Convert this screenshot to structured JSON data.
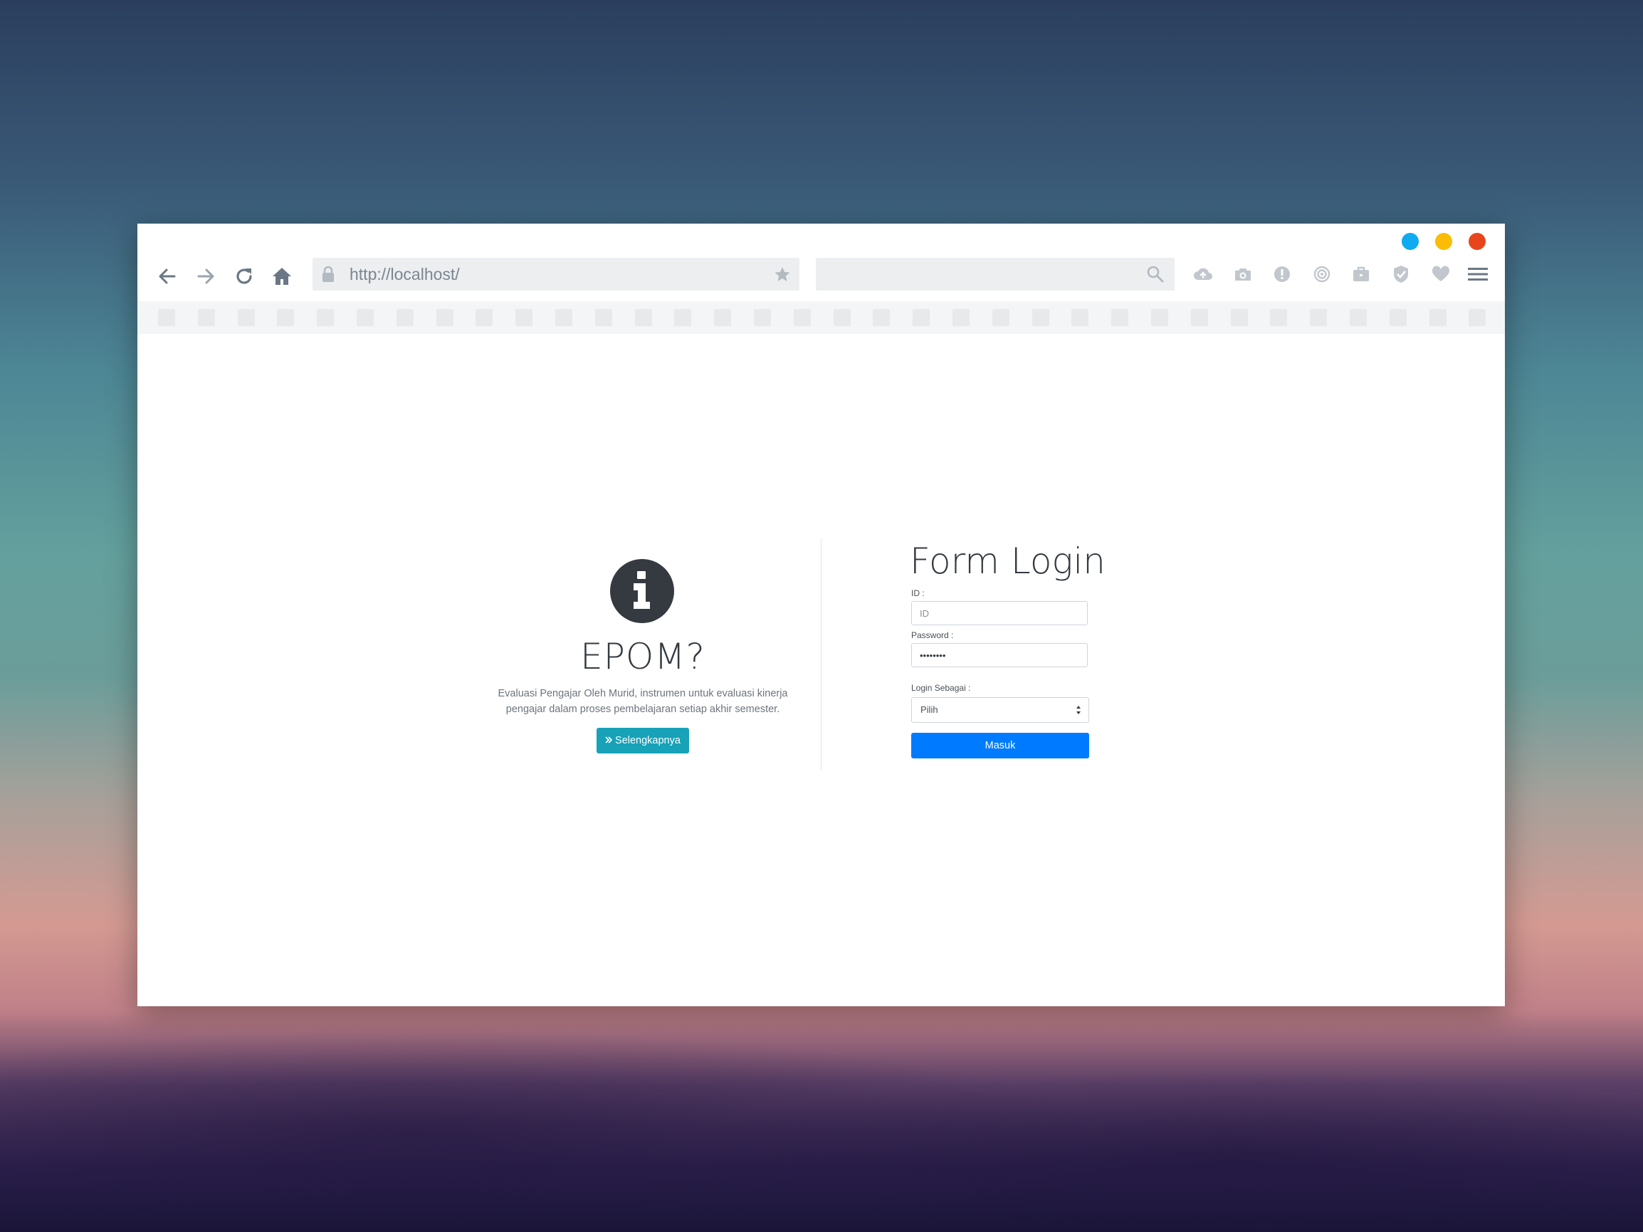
{
  "browser": {
    "url": "http://localhost/",
    "search_placeholder": "",
    "window_controls": [
      "blue",
      "yellow",
      "red"
    ],
    "nav_icons": [
      "back-arrow-icon",
      "forward-arrow-icon",
      "reload-icon",
      "home-icon"
    ],
    "toolbar_icons": [
      "cloud-upload-icon",
      "camera-icon",
      "alert-icon",
      "broadcast-icon",
      "briefcase-icon",
      "shield-check-icon",
      "heart-icon",
      "hamburger-menu-icon"
    ],
    "bookmark_placeholder_count": 34
  },
  "info": {
    "icon": "info-circle-icon",
    "title": "EPOM?",
    "description_line1": "Evaluasi Pengajar Oleh Murid, instrumen untuk evaluasi kinerja",
    "description_line2": "pengajar dalam proses pembelajaran setiap akhir semester.",
    "more_button": "Selengkapnya"
  },
  "login": {
    "title": "Form Login",
    "id_label": "ID :",
    "id_placeholder": "ID",
    "password_label": "Password :",
    "password_value": "••••••••",
    "role_label": "Login Sebagai :",
    "role_selected": "Pilih",
    "submit_label": "Masuk"
  },
  "colors": {
    "accent_primary": "#007bff",
    "accent_info": "#17a2b8",
    "dark": "#343a40",
    "dot_blue": "#10aaf0",
    "dot_yellow": "#fbbc05",
    "dot_red": "#e8451c"
  }
}
